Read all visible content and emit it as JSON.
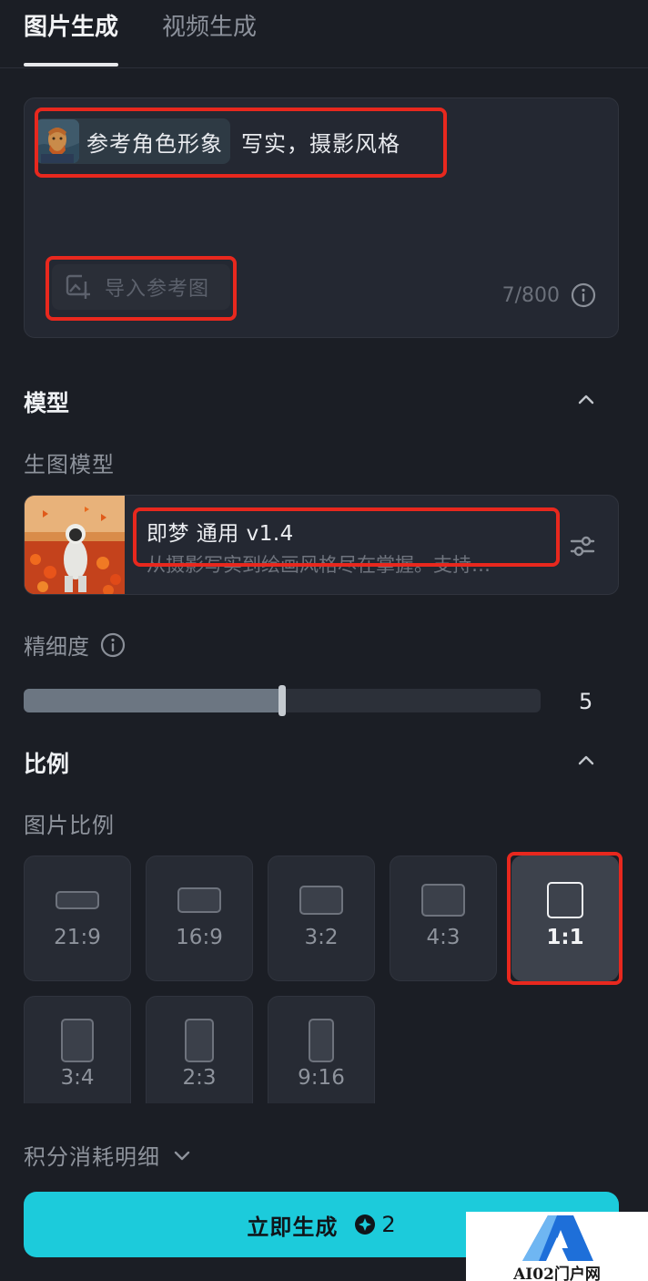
{
  "tabs": [
    {
      "label": "图片生成",
      "active": true
    },
    {
      "label": "视频生成",
      "active": false
    }
  ],
  "prompt": {
    "reference_chip_label": "参考角色形象",
    "text": "写实，摄影风格",
    "import_label": "导入参考图",
    "counter": "7/800",
    "icons": {
      "import": "image-plus-icon",
      "info": "info-icon"
    }
  },
  "model_section": {
    "title": "模型",
    "sub_label": "生图模型",
    "model_name": "即梦 通用 v1.4",
    "model_desc": "从摄影写实到绘画风格尽在掌握。支持…",
    "settings_icon": "sliders-icon"
  },
  "detail": {
    "label": "精细度",
    "value": "5",
    "level_fraction": 0.5
  },
  "ratio_section": {
    "title": "比例",
    "sub_label": "图片比例",
    "options": [
      {
        "label": "21:9",
        "selected": false
      },
      {
        "label": "16:9",
        "selected": false
      },
      {
        "label": "3:2",
        "selected": false
      },
      {
        "label": "4:3",
        "selected": false
      },
      {
        "label": "1:1",
        "selected": true
      },
      {
        "label": "3:4",
        "selected": false
      },
      {
        "label": "2:3",
        "selected": false
      },
      {
        "label": "9:16",
        "selected": false
      }
    ]
  },
  "cost": {
    "label": "积分消耗明细"
  },
  "generate": {
    "label": "立即生成",
    "credits": "2"
  },
  "watermark": {
    "text": "AI02门户网"
  },
  "colors": {
    "accent": "#1ccbdb",
    "highlight": "#e8281e",
    "background": "#1b1e25"
  }
}
